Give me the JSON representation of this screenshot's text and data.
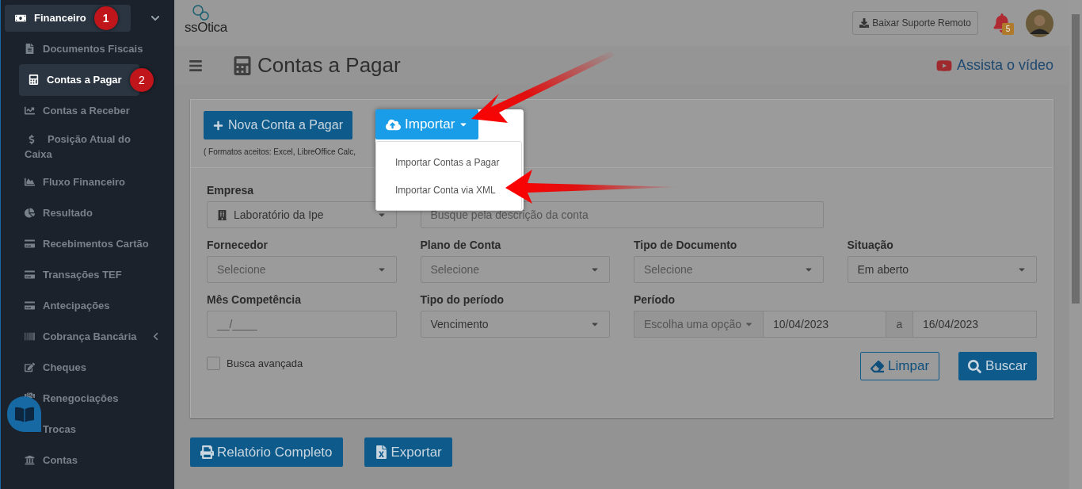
{
  "sidebar": {
    "header": {
      "label": "Financeiro",
      "badge": "1",
      "expanded": true
    },
    "items": [
      {
        "label": "Documentos Fiscais",
        "selected": false
      },
      {
        "label": "Contas a Pagar",
        "selected": true,
        "badge": "2"
      },
      {
        "label": "Contas a Receber",
        "selected": false
      },
      {
        "label": "Posição Atual do Caixa",
        "selected": false
      },
      {
        "label": "Fluxo Financeiro",
        "selected": false
      },
      {
        "label": "Resultado",
        "selected": false
      },
      {
        "label": "Recebimentos Cartão",
        "selected": false
      },
      {
        "label": "Transações TEF",
        "selected": false
      },
      {
        "label": "Antecipações",
        "selected": false
      },
      {
        "label": "Cobrança Bancária",
        "selected": false,
        "has_submenu": true
      },
      {
        "label": "Cheques",
        "selected": false
      },
      {
        "label": "Renegociações",
        "selected": false
      },
      {
        "label": "Trocas",
        "selected": false
      },
      {
        "label": "Contas",
        "selected": false
      }
    ]
  },
  "topbar": {
    "logo": "ssOtica",
    "support_button": "Baixar Suporte Remoto",
    "notifications": "5"
  },
  "page": {
    "title": "Contas a Pagar",
    "video_link": "Assista o vídeo"
  },
  "card": {
    "new_button": "Nova Conta a Pagar",
    "import": {
      "label": "Importar",
      "expanded": true,
      "menu": [
        "Importar Contas a Pagar",
        "Importar Conta via XML"
      ]
    },
    "hint": "( Formatos aceitos: Excel, LibreOffice Calc,",
    "rows": [
      [
        {
          "label": "Empresa",
          "kind": "select",
          "value": "Laboratório da Ipe"
        },
        {
          "kind": "input",
          "placeholder": "Busque pela descrição da conta"
        }
      ],
      [
        {
          "label": "Fornecedor",
          "kind": "select",
          "placeholder": "Selecione"
        },
        {
          "label": "Plano de Conta",
          "kind": "select",
          "placeholder": "Selecione"
        },
        {
          "label": "Tipo de Documento",
          "kind": "select",
          "placeholder": "Selecione"
        },
        {
          "label": "Situação",
          "kind": "select",
          "value": "Em aberto"
        }
      ],
      [
        {
          "label": "Mês Competência",
          "kind": "input",
          "placeholder": "__/____"
        },
        {
          "label": "Tipo do período",
          "kind": "select",
          "value": "Vencimento"
        },
        {
          "label": "Período",
          "kind": "range",
          "option": "Escolha uma opção",
          "from": "10/04/2023",
          "sep": "a",
          "to": "16/04/2023"
        }
      ]
    ],
    "advanced": {
      "label": "Busca avançada",
      "checked": false
    },
    "clear_button": "Limpar",
    "search_button": "Buscar"
  },
  "actions": [
    "Relatório Completo",
    "Exportar"
  ]
}
